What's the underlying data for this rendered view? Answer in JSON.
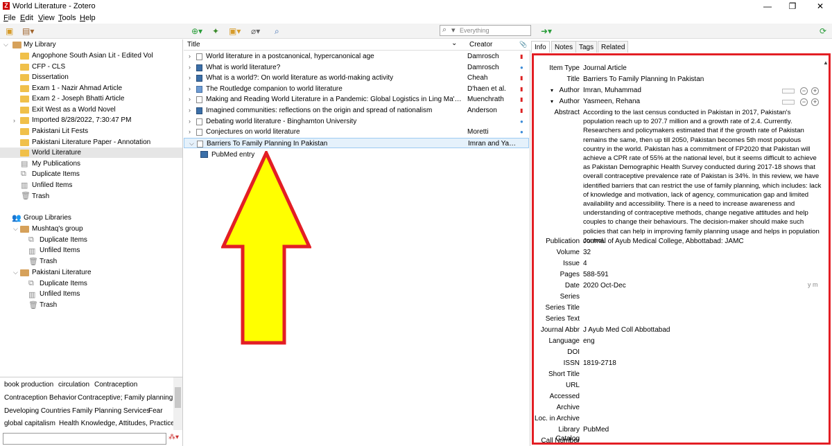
{
  "window": {
    "title": "World Literature - Zotero",
    "min": "—",
    "max": "❐",
    "close": "✕"
  },
  "menu": [
    "File",
    "Edit",
    "View",
    "Tools",
    "Help"
  ],
  "toolbar": {
    "search_placeholder": "Everything",
    "search_mode": "▾"
  },
  "collections": {
    "library": "My Library",
    "items": [
      "Angophone South Asian Lit - Edited Vol",
      "CFP - CLS",
      "Dissertation",
      "Exam 1 - Nazir Ahmad Article",
      "Exam 2 - Joseph Bhatti Article",
      "Exit West as a World Novel",
      "Imported 8/28/2022, 7:30:47 PM",
      "Pakistani Lit Fests",
      "Pakistani Literature Paper - Annotation",
      "World Literature"
    ],
    "lib_special": [
      "My Publications",
      "Duplicate Items",
      "Unfiled Items",
      "Trash"
    ],
    "group_header": "Group Libraries",
    "groups": [
      {
        "name": "Mushtaq's group",
        "children": [
          "Duplicate Items",
          "Unfiled Items",
          "Trash"
        ]
      },
      {
        "name": "Pakistani Literature",
        "children": [
          "Duplicate Items",
          "Unfiled Items",
          "Trash"
        ]
      }
    ]
  },
  "tags": [
    [
      "book production",
      "circulation",
      "Contraception"
    ],
    [
      "Contraception Behavior",
      "Contraceptive; Family planning"
    ],
    [
      "Developing Countries",
      "Family Planning Services",
      "Fear"
    ],
    [
      "global capitalism",
      "Health Knowledge, Attitudes, Practice"
    ]
  ],
  "items": {
    "columns": {
      "title": "Title",
      "creator": "Creator",
      "sort": "⌄",
      "attach": "📎"
    },
    "rows": [
      {
        "title": "World literature in a postcanonical, hypercanonical age",
        "creator": "Damrosch",
        "att": "pdf",
        "icon": "doc"
      },
      {
        "title": "What is world literature?",
        "creator": "Damrosch",
        "att": "dot",
        "icon": "book"
      },
      {
        "title": "What is a world?: On world literature as world-making activity",
        "creator": "Cheah",
        "att": "pdf",
        "icon": "book"
      },
      {
        "title": "The Routledge companion to world literature",
        "creator": "D'haen et al.",
        "att": "pdf",
        "icon": "blue"
      },
      {
        "title": "Making and Reading World Literature in a Pandemic: Global Logistics in Ling Ma's Sever...",
        "creator": "Muenchrath",
        "att": "pdf",
        "icon": "doc"
      },
      {
        "title": "Imagined communities: reflections on the origin and spread of nationalism",
        "creator": "Anderson",
        "att": "pdf",
        "icon": "book"
      },
      {
        "title": "Debating world literature - Binghamton University",
        "creator": "",
        "att": "dot",
        "icon": "doc"
      },
      {
        "title": "Conjectures on world literature",
        "creator": "Moretti",
        "att": "dot",
        "icon": "doc"
      },
      {
        "title": "Barriers To Family Planning In Pakistan",
        "creator": "Imran and Yas...",
        "att": "",
        "icon": "doc"
      }
    ],
    "child": "PubMed entry"
  },
  "tabs": [
    "Info",
    "Notes",
    "Tags",
    "Related"
  ],
  "info": {
    "item_type_label": "Item Type",
    "item_type": "Journal Article",
    "title_label": "Title",
    "title": "Barriers To Family Planning In Pakistan",
    "author_label": "Author",
    "author1": "Imran, Muhammad",
    "author2": "Yasmeen, Rehana",
    "abstract_label": "Abstract",
    "abstract": "According to the last census conducted in Pakistan in 2017, Pakistan's population reach up to 207.7 million and a growth rate of 2.4. Currently. Researchers and policymakers estimated that if the growth rate of Pakistan remains the same, then up till 2050, Pakistan becomes 5th most populous country in the world. Pakistan has a commitment of FP2020 that Pakistan will achieve a CPR rate of 55% at the national level, but it seems difficult to achieve as Pakistan Demographic Health Survey conducted during 2017-18 shows that overall contraceptive prevalence rate of Pakistan is 34%. In this review, we have identified barriers that can restrict the use of family planning, which includes: lack of knowledge and motivation, lack of agency, communication gap and limited availability and accessibility. There is a need to increase awareness and understanding of contraceptive methods, change negative attitudes and help couples to change their behaviours. The decision-maker should make such policies that can help in improving family planning usage and helps in population control.",
    "publication_label": "Publication",
    "publication": "Journal of Ayub Medical College, Abbottabad: JAMC",
    "volume_label": "Volume",
    "volume": "32",
    "issue_label": "Issue",
    "issue": "4",
    "pages_label": "Pages",
    "pages": "588-591",
    "date_label": "Date",
    "date": "2020 Oct-Dec",
    "date_fmt": "y m",
    "series_label": "Series",
    "series_title_label": "Series Title",
    "series_text_label": "Series Text",
    "journal_abbr_label": "Journal Abbr",
    "journal_abbr": "J Ayub Med Coll Abbottabad",
    "language_label": "Language",
    "language": "eng",
    "doi_label": "DOI",
    "issn_label": "ISSN",
    "issn": "1819-2718",
    "short_title_label": "Short Title",
    "url_label": "URL",
    "accessed_label": "Accessed",
    "archive_label": "Archive",
    "loc_label": "Loc. in Archive",
    "catalog_label": "Library Catalog",
    "catalog": "PubMed",
    "call_label": "Call Number"
  },
  "colors": {
    "highlight_border": "#e31e24",
    "arrow_fill": "#ffff00",
    "arrow_stroke": "#e31e24",
    "selection": "#e5f1fb"
  }
}
